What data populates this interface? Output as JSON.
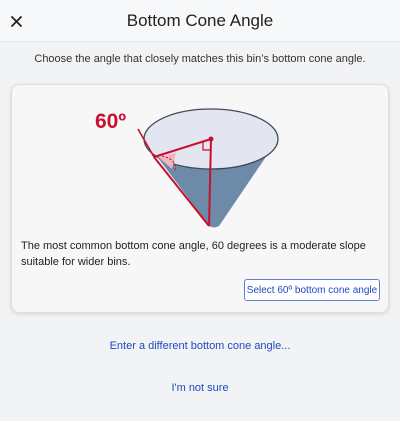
{
  "header": {
    "title": "Bottom Cone Angle",
    "close_icon": "close-icon"
  },
  "instruction": "Choose the angle that closely matches this bin’s bottom cone angle.",
  "card": {
    "angle_label": "60º",
    "description": "The most common bottom cone angle, 60 degrees is a moderate slope suitable for wider bins.",
    "select_button_label": "Select 60º bottom cone angle",
    "illustration_icon": "cone-angle-diagram",
    "accent_color": "#c8102e",
    "cone_color": "#6d8aa8"
  },
  "links": {
    "different_angle": "Enter a different bottom cone angle...",
    "not_sure": "I'm not sure"
  }
}
